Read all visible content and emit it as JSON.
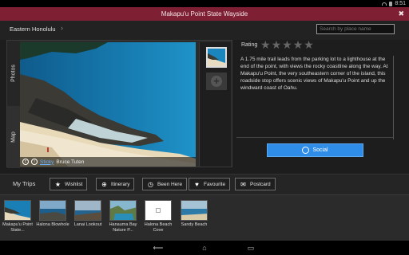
{
  "status": {
    "time": "8:51"
  },
  "window": {
    "title": "Makapu'u Point State Wayside",
    "close_glyph": "✖"
  },
  "subbar": {
    "region": "Eastern Honolulu",
    "region_chevron": "›"
  },
  "search": {
    "placeholder": "Search by place name",
    "value": ""
  },
  "gallery": {
    "tabs": [
      {
        "label": "Photos"
      },
      {
        "label": "Map"
      }
    ],
    "credit_link": "Sticky",
    "credit_author": "Bruce Tuten",
    "add_glyph": "+"
  },
  "info": {
    "rating_label": "Rating",
    "rating_value": 0,
    "rating_max": 5,
    "star_glyph": "★",
    "description": "A 1.75 mile trail leads from the parking lot to a lighthouse at the end of the point, with views the rocky coastline along the way. At Makapu'u Point, the very southeastern corner of the island, this roadside stop offers scenic views of Makapu'u Point and up the windward coast of Oahu.",
    "social_label": "Social"
  },
  "trips": {
    "label": "My Trips",
    "buttons": [
      {
        "label": "Wishlist",
        "icon": "star-icon",
        "glyph": "★"
      },
      {
        "label": "Itinerary",
        "icon": "plus-circle-icon",
        "glyph": "⊕"
      },
      {
        "label": "Been Here",
        "icon": "clock-icon",
        "glyph": "◷"
      },
      {
        "label": "Favourite",
        "icon": "heart-icon",
        "glyph": "♥"
      },
      {
        "label": "Postcard",
        "icon": "postcard-icon",
        "glyph": "✉"
      }
    ],
    "items": [
      {
        "name": "Makapu'u Point State..."
      },
      {
        "name": "Halona Blowhole"
      },
      {
        "name": "Lanai Lookout"
      },
      {
        "name": "Hanauma Bay Nature P..."
      },
      {
        "name": "Halona Beach Cove"
      },
      {
        "name": "Sandy Beach"
      }
    ]
  },
  "nav": {
    "back_glyph": "⟵",
    "home_glyph": "⌂",
    "recents_glyph": "▭"
  },
  "colors": {
    "accent": "#7e1f33",
    "social": "#2f8de8",
    "background": "#1d1d1d"
  }
}
